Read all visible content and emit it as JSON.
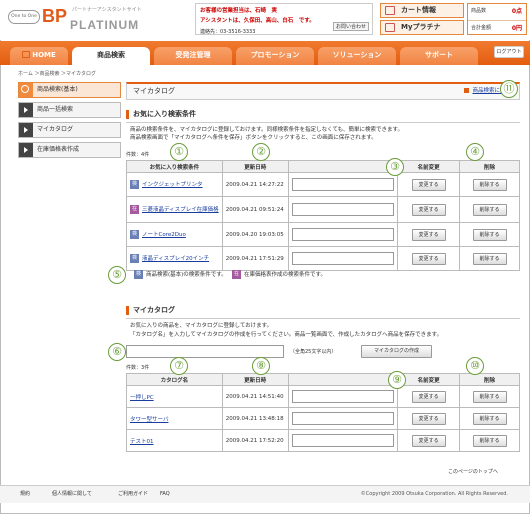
{
  "header": {
    "logo_circle": "One to One",
    "logo_main": "BP",
    "logo_sub_word": "PLATINUM",
    "logo_tagline": "パートナーアシスタントサイト",
    "contact_line1": "お客様の営業担当は、石崎　実",
    "contact_line2": "アシスタントは、久保田、高山、白石　です。",
    "contact_line3": "連絡先：03-3516-3333",
    "contact_ask": "お問い合わせ",
    "cart_label": "カート情報",
    "myplatinum_label": "Myプラチナ",
    "item_count_label": "商品数",
    "item_count_value": "0点",
    "total_label": "合計金額",
    "total_value": "0円"
  },
  "nav": {
    "tabs": [
      "HOME",
      "商品検索",
      "受発注管理",
      "プロモーション",
      "ソリューション",
      "サポート"
    ],
    "logout": "ログアウト"
  },
  "breadcrumb": "ホーム ＞商品検索 ＞マイカタログ",
  "sidebar": {
    "items": [
      "商品検索(基本)",
      "商品一括検索",
      "マイカタログ",
      "在庫価格表作成"
    ]
  },
  "page": {
    "title": "マイカタログ",
    "back_link": "商品検索に戻る"
  },
  "favorites": {
    "heading": "お気に入り検索条件",
    "desc1": "商品の検索条件を、マイカタログに登録しておけます。同様検索条件を指定しなくても、簡単に検索できます。",
    "desc2": "商品検索画面で「マイカタログへ条件を保存」ボタンをクリックすると、この画面に保存されます。",
    "count": "件数：4件",
    "headers": [
      "お気に入り検索条件",
      "更新日時",
      "",
      "名前変更",
      "削除"
    ],
    "rows": [
      {
        "icon": "検",
        "icon_type": "a",
        "name": "インクジェットプリンタ",
        "date": "2009.04.21 14:27:22"
      },
      {
        "icon": "在",
        "icon_type": "b",
        "name": "三菱液晶ディスプレイ在庫価格",
        "date": "2009.04.21 09:51:24"
      },
      {
        "icon": "検",
        "icon_type": "a",
        "name": "ノートCore2Duo",
        "date": "2009.04.20 19:03:05"
      },
      {
        "icon": "検",
        "icon_type": "a",
        "name": "液晶ディスプレイ20インチ",
        "date": "2009.04.21 17:51:29"
      }
    ],
    "rename_button": "変更する",
    "delete_button": "削除する",
    "legend_a_icon": "検",
    "legend_a": "商品検索(基本)の検索条件です。",
    "legend_b_icon": "在",
    "legend_b": "在庫価格表作成の検索条件です。"
  },
  "catalog": {
    "heading": "マイカタログ",
    "desc1": "お気に入りの商品を、マイカタログに登録しておけます。",
    "desc2": "「カタログ名」を入力してマイカタログの作成を行ってください。商品一覧画面で、作成したカタログへ商品を保存できます。",
    "new_hint": "（全角25文字以内）",
    "create_button": "マイカタログの作成",
    "count": "件数：3件",
    "headers": [
      "カタログ名",
      "更新日時",
      "",
      "名前変更",
      "削除"
    ],
    "rows": [
      {
        "name": "一押しPC",
        "date": "2009.04.21 14:51:40"
      },
      {
        "name": "タワー型サーバ",
        "date": "2009.04.21 13:48:18"
      },
      {
        "name": "テスト01",
        "date": "2009.04.21 17:52:20"
      }
    ],
    "rename_button": "変更する",
    "delete_button": "削除する"
  },
  "callouts": [
    "①",
    "②",
    "③",
    "④",
    "⑤",
    "⑥",
    "⑦",
    "⑧",
    "⑨",
    "⑩",
    "⑪"
  ],
  "to_top": "このページのトップへ",
  "footer": {
    "links": [
      "規約",
      "個人情報に関して",
      "ご利用ガイド",
      "FAQ"
    ],
    "copyright": "©Copyright 2009 Otsuka Corporation. All Rights Reserved."
  }
}
